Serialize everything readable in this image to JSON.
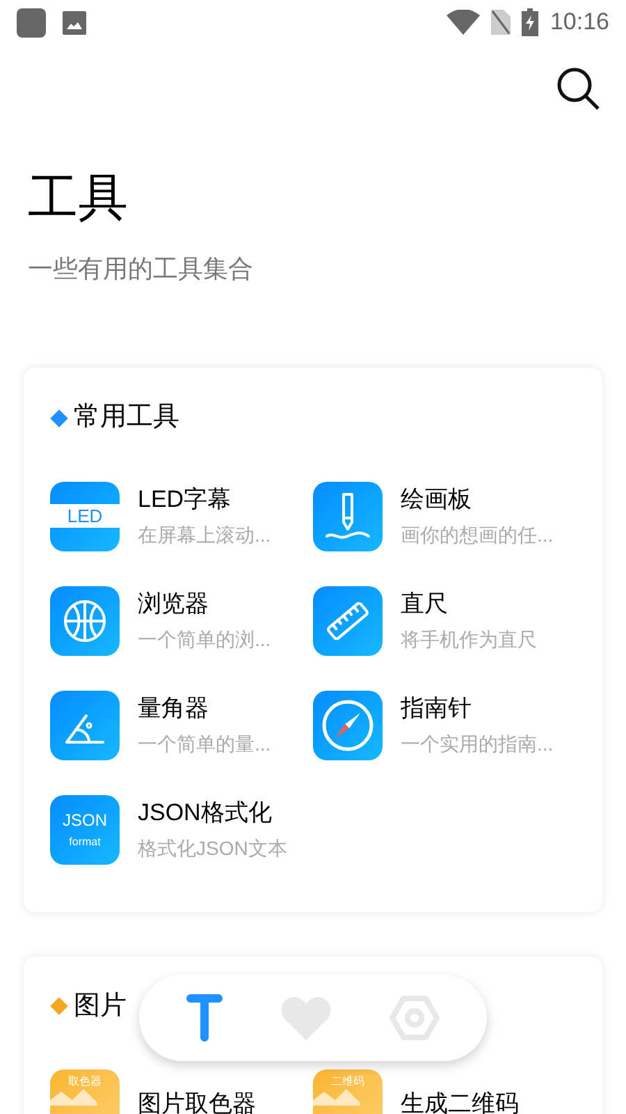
{
  "status_bar": {
    "time": "10:16"
  },
  "header": {
    "title": "工具",
    "subtitle": "一些有用的工具集合"
  },
  "sections": [
    {
      "title": "常用工具",
      "color": "#1e90ff",
      "items": [
        {
          "kind": "led",
          "icon_text": [
            "LED"
          ],
          "title": "LED字幕",
          "description": "在屏幕上滚动..."
        },
        {
          "kind": "pen",
          "title": "绘画板",
          "description": "画你的想画的任..."
        },
        {
          "kind": "globe",
          "title": "浏览器",
          "description": "一个简单的浏..."
        },
        {
          "kind": "ruler",
          "title": "直尺",
          "description": "将手机作为直尺"
        },
        {
          "kind": "protractor",
          "title": "量角器",
          "description": "一个简单的量..."
        },
        {
          "kind": "compass",
          "title": "指南针",
          "description": "一个实用的指南..."
        },
        {
          "kind": "json",
          "icon_text": [
            "JSON",
            "format"
          ],
          "title": "JSON格式化",
          "description": "格式化JSON文本"
        }
      ]
    },
    {
      "title": "图片",
      "color": "#f5a623",
      "items": [
        {
          "kind": "image",
          "icon_text": [
            "取色器"
          ],
          "title": "图片取色器"
        },
        {
          "kind": "image",
          "icon_text": [
            "二维码"
          ],
          "title": "生成二维码"
        }
      ]
    }
  ],
  "nav": [
    {
      "kind": "tools",
      "selected": true
    },
    {
      "kind": "favorites",
      "selected": false
    },
    {
      "kind": "settings",
      "selected": false
    }
  ]
}
